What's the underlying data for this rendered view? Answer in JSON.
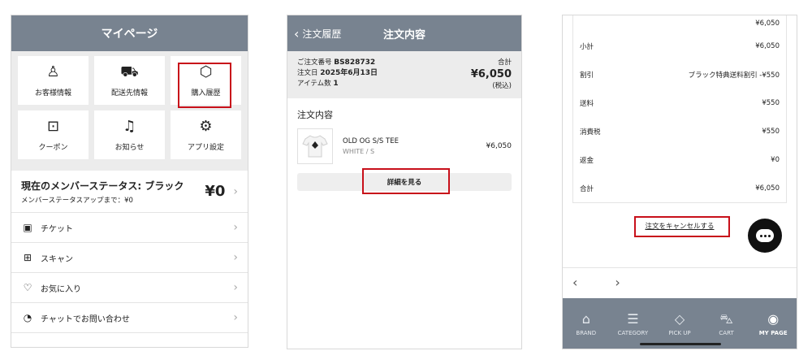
{
  "panel1": {
    "title": "マイページ",
    "tiles": [
      {
        "icon": "user-icon",
        "glyph": "♙",
        "label": "お客様情報"
      },
      {
        "icon": "truck-icon",
        "glyph": "⛟",
        "label": "配送先情報"
      },
      {
        "icon": "box-icon",
        "glyph": "⬡",
        "label": "購入履歴"
      },
      {
        "icon": "coupon-icon",
        "glyph": "⊡",
        "label": "クーポン"
      },
      {
        "icon": "bell-icon",
        "glyph": "♫",
        "label": "お知らせ"
      },
      {
        "icon": "gear-icon",
        "glyph": "⚙",
        "label": "アプリ設定"
      }
    ],
    "status_title": "現在のメンバーステータス: ブラック",
    "status_sub": "メンバーステータスアップまで：¥0",
    "status_amount": "¥0",
    "list": [
      {
        "icon": "ticket-icon",
        "glyph": "▣",
        "label": "チケット"
      },
      {
        "icon": "qr-icon",
        "glyph": "⊞",
        "label": "スキャン"
      },
      {
        "icon": "heart-icon",
        "glyph": "♡",
        "label": "お気に入り"
      },
      {
        "icon": "chat-icon",
        "glyph": "◔",
        "label": "チャットでお問い合わせ"
      }
    ]
  },
  "panel2": {
    "back_label": "注文履歴",
    "title": "注文内容",
    "order_no_label": "ご注文番号",
    "order_no": "BS828732",
    "date_label": "注文日",
    "date": "2025年6月13日",
    "count_label": "アイテム数",
    "count": "1",
    "total_label": "合計",
    "total": "¥6,050",
    "tax_note": "(税込)",
    "section_title": "注文内容",
    "item_name": "OLD OG S/S TEE",
    "item_variant": "WHITE / S",
    "item_price": "¥6,050",
    "detail_button": "詳細を見る"
  },
  "panel3": {
    "top_value": "¥6,050",
    "rows": [
      {
        "label": "小計",
        "value": "¥6,050"
      },
      {
        "label": "割引",
        "value": "ブラック特典送料割引 -¥550"
      },
      {
        "label": "送料",
        "value": "¥550"
      },
      {
        "label": "消費税",
        "value": "¥550"
      },
      {
        "label": "返金",
        "value": "¥0"
      },
      {
        "label": "合計",
        "value": "¥6,050"
      }
    ],
    "cancel_label": "注文をキャンセルする",
    "tabs": [
      {
        "icon": "store-icon",
        "glyph": "⌂",
        "label": "BRAND"
      },
      {
        "icon": "list-icon",
        "glyph": "☰",
        "label": "CATEGORY"
      },
      {
        "icon": "tag-icon",
        "glyph": "◇",
        "label": "PICK UP"
      },
      {
        "icon": "cart-icon",
        "glyph": "⛍",
        "label": "CART"
      },
      {
        "icon": "account-icon",
        "glyph": "◉",
        "label": "MY PAGE"
      }
    ]
  },
  "colors": {
    "header": "#788390",
    "highlight": "#c8101a"
  }
}
